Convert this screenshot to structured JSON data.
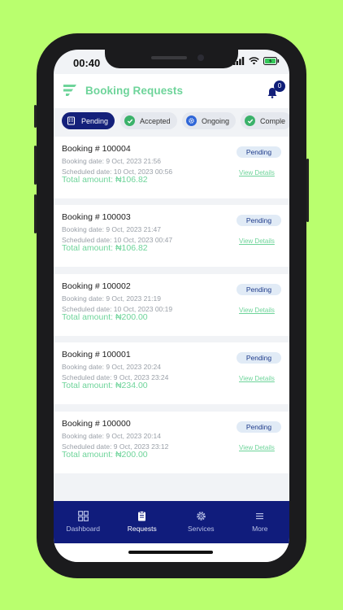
{
  "status_bar": {
    "time": "00:40"
  },
  "header": {
    "title": "Booking Requests",
    "notification_count": "0"
  },
  "tabs": [
    {
      "label": "Pending",
      "icon": "building-icon",
      "active": true
    },
    {
      "label": "Accepted",
      "icon": "check-circle-icon"
    },
    {
      "label": "Ongoing",
      "icon": "gear-circle-icon"
    },
    {
      "label": "Comple",
      "icon": "check-circle-icon"
    }
  ],
  "bookings": [
    {
      "title": "Booking # 100004",
      "booking_date": "Booking date:  9 Oct, 2023 21:56",
      "scheduled_date": "Scheduled date: 10 Oct, 2023 00:56",
      "total": "Total amount: ₦106.82",
      "status": "Pending",
      "link": "View Details"
    },
    {
      "title": "Booking # 100003",
      "booking_date": "Booking date:  9 Oct, 2023 21:47",
      "scheduled_date": "Scheduled date: 10 Oct, 2023 00:47",
      "total": "Total amount: ₦106.82",
      "status": "Pending",
      "link": "View Details"
    },
    {
      "title": "Booking # 100002",
      "booking_date": "Booking date:  9 Oct, 2023 21:19",
      "scheduled_date": "Scheduled date: 10 Oct, 2023 00:19",
      "total": "Total amount: ₦200.00",
      "status": "Pending",
      "link": "View Details"
    },
    {
      "title": "Booking # 100001",
      "booking_date": "Booking date:  9 Oct, 2023 20:24",
      "scheduled_date": "Scheduled date: 9 Oct, 2023 23:24",
      "total": "Total amount: ₦234.00",
      "status": "Pending",
      "link": "View Details"
    },
    {
      "title": "Booking # 100000",
      "booking_date": "Booking date:  9 Oct, 2023 20:14",
      "scheduled_date": "Scheduled date: 9 Oct, 2023 23:12",
      "total": "Total amount: ₦200.00",
      "status": "Pending",
      "link": "View Details"
    }
  ],
  "nav": [
    {
      "label": "Dashboard",
      "icon": "dashboard-icon"
    },
    {
      "label": "Requests",
      "icon": "clipboard-icon",
      "active": true
    },
    {
      "label": "Services",
      "icon": "gear-icon"
    },
    {
      "label": "More",
      "icon": "menu-icon"
    }
  ],
  "colors": {
    "background": "#b9ff6e",
    "brand_green": "#6ed49a",
    "brand_navy": "#101c7c"
  }
}
